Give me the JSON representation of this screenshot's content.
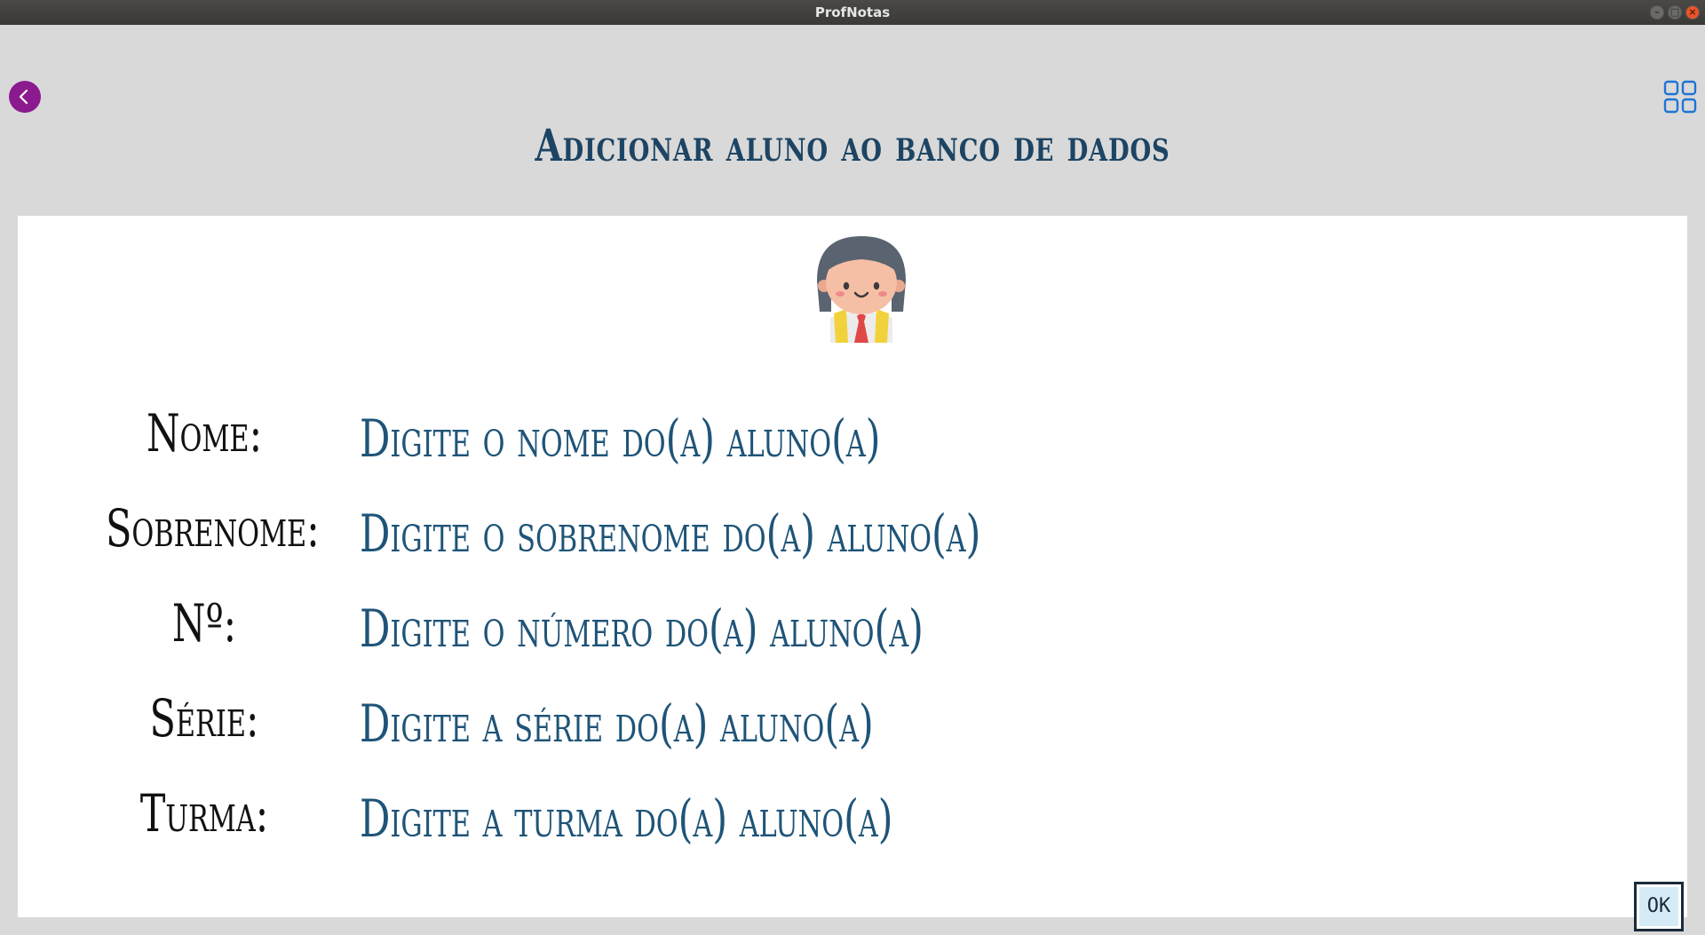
{
  "window": {
    "title": "ProfNotas",
    "minimize_glyph": "–",
    "maximize_glyph": "□",
    "close_glyph": "×"
  },
  "header": {
    "title": "Adicionar aluno ao banco de dados",
    "back_icon": "chevron-left-icon",
    "menu_icon": "grid-icon",
    "back_color": "#8b1a8e",
    "menu_color": "#1e74d6"
  },
  "form": {
    "avatar": "student-avatar",
    "fields": [
      {
        "label": "Nome:",
        "placeholder": "Digite o nome do(a) aluno(a)",
        "value": ""
      },
      {
        "label": "Sobrenome:",
        "placeholder": "Digite o sobrenome do(a) aluno(a)",
        "value": ""
      },
      {
        "label": "Nº:",
        "placeholder": "Digite o número do(a) aluno(a)",
        "value": ""
      },
      {
        "label": "Série:",
        "placeholder": "Digite a série do(a) aluno(a)",
        "value": ""
      },
      {
        "label": "Turma:",
        "placeholder": "Digite a turma do(a) aluno(a)",
        "value": ""
      }
    ],
    "ok_label": "OK"
  },
  "colors": {
    "background": "#d9d9d9",
    "card": "#ffffff",
    "title": "#1d4463",
    "label": "#111111",
    "field_text": "#1f5478",
    "ok_button": "#d5ecf7"
  }
}
